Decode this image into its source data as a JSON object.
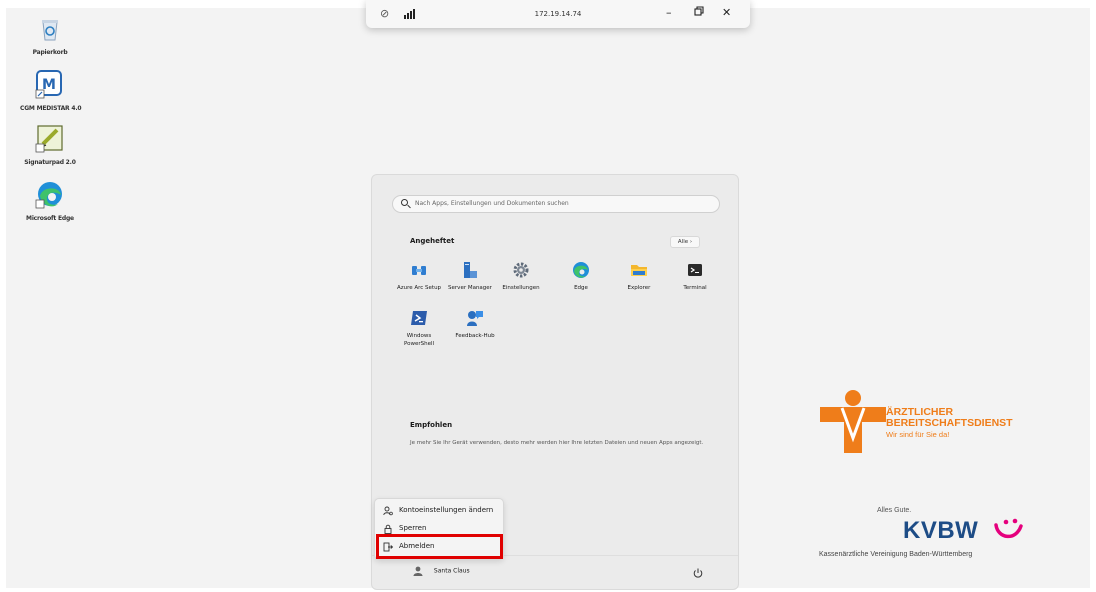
{
  "rdp_bar": {
    "ip": "172.19.14.74",
    "minimize": "–",
    "close": "✕"
  },
  "desktop_icons": [
    {
      "label": "Papierkorb",
      "icon": "recycle-bin-icon"
    },
    {
      "label": "CGM MEDISTAR 4.0",
      "icon": "medistar-icon"
    },
    {
      "label": "Signaturpad 2.0",
      "icon": "signature-icon"
    },
    {
      "label": "Microsoft Edge",
      "icon": "edge-icon"
    }
  ],
  "start_menu": {
    "search_placeholder": "Nach Apps, Einstellungen und Dokumenten suchen",
    "pinned_title": "Angeheftet",
    "all_button": "Alle  ›",
    "pinned_apps": [
      {
        "label": "Azure Arc Setup",
        "icon": "azure-arc-icon"
      },
      {
        "label": "Server Manager",
        "icon": "server-manager-icon"
      },
      {
        "label": "Einstellungen",
        "icon": "settings-gear-icon"
      },
      {
        "label": "Edge",
        "icon": "edge-icon"
      },
      {
        "label": "Explorer",
        "icon": "folder-icon"
      },
      {
        "label": "Terminal",
        "icon": "terminal-icon"
      },
      {
        "label": "Windows PowerShell",
        "icon": "powershell-icon"
      },
      {
        "label": "Feedback-Hub",
        "icon": "feedback-hub-icon"
      }
    ],
    "recommended_title": "Empfohlen",
    "recommended_text": "Je mehr Sie Ihr Gerät verwenden, desto mehr werden hier Ihre letzten Dateien und neuen Apps angezeigt.",
    "user_name": "Santa Claus"
  },
  "user_flyout": {
    "items": [
      {
        "label": "Kontoeinstellungen ändern",
        "icon": "account-settings-icon"
      },
      {
        "label": "Sperren",
        "icon": "lock-icon"
      },
      {
        "label": "Abmelden",
        "icon": "sign-out-icon"
      }
    ]
  },
  "branding": {
    "aed_line1": "ÄRZTLICHER",
    "aed_line2": "BEREITSCHAFTSDIENST",
    "aed_line3": "Wir sind für Sie da!",
    "kvbw_greeting": "Alles Gute.",
    "kvbw_name": "KVBW",
    "kvbw_full": "Kassenärztliche Vereinigung Baden-Württemberg"
  },
  "colors": {
    "aed_orange": "#ef7d1a",
    "kvbw_blue": "#1d4c86",
    "highlight_red": "#e00000"
  }
}
